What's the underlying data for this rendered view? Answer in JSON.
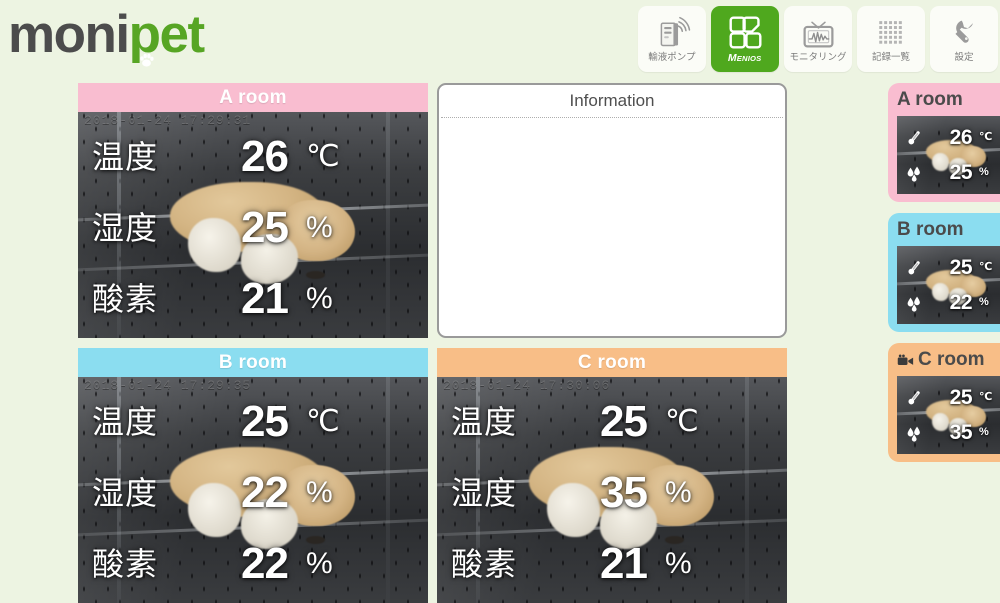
{
  "brand": {
    "name_part1": "moni",
    "name_part2": "pet",
    "paw_icon": "paw-print-icon",
    "color_dark": "#4c4c4c",
    "color_green": "#57a524"
  },
  "toolbar": {
    "buttons": [
      {
        "id": "infusion-pump",
        "label": "輸液ポンプ",
        "icon": "infusion-pump-icon",
        "active": false
      },
      {
        "id": "menios",
        "label": "Menios",
        "icon": "grid-squares-icon",
        "active": true
      },
      {
        "id": "monitoring",
        "label": "モニタリング",
        "icon": "monitor-waveform-icon",
        "active": false
      },
      {
        "id": "record-list",
        "label": "記録一覧",
        "icon": "dot-grid-icon",
        "active": false
      },
      {
        "id": "settings",
        "label": "設定",
        "icon": "wrench-icon",
        "active": false
      }
    ]
  },
  "info_panel": {
    "title": "Information",
    "body_text": ""
  },
  "rooms": [
    {
      "id": "a",
      "title": "A room",
      "header_color": "#f9bdd0",
      "timestamp": "2018-01-24 17:29:31",
      "readouts": [
        {
          "label": "温度",
          "value": "26",
          "unit": "℃"
        },
        {
          "label": "湿度",
          "value": "25",
          "unit": "%"
        },
        {
          "label": "酸素",
          "value": "21",
          "unit": "%"
        }
      ]
    },
    {
      "id": "b",
      "title": "B room",
      "header_color": "#8bddf0",
      "timestamp": "2018-01-24 17:29:35",
      "readouts": [
        {
          "label": "温度",
          "value": "25",
          "unit": "℃"
        },
        {
          "label": "湿度",
          "value": "22",
          "unit": "%"
        },
        {
          "label": "酸素",
          "value": "22",
          "unit": "%"
        }
      ]
    },
    {
      "id": "c",
      "title": "C room",
      "header_color": "#f8be87",
      "timestamp": "2018-01-24 17:30:06",
      "readouts": [
        {
          "label": "温度",
          "value": "25",
          "unit": "℃"
        },
        {
          "label": "湿度",
          "value": "35",
          "unit": "%"
        },
        {
          "label": "酸素",
          "value": "21",
          "unit": "%"
        }
      ]
    }
  ],
  "sidebar": {
    "cards": [
      {
        "id": "a",
        "title": "A room",
        "color": "#f9bdd0",
        "has_camera_icon": false,
        "temperature": {
          "icon": "thermometer-icon",
          "value": "26",
          "unit": "℃"
        },
        "humidity": {
          "icon": "water-drops-icon",
          "value": "25",
          "unit": "%"
        }
      },
      {
        "id": "b",
        "title": "B room",
        "color": "#8bddf0",
        "has_camera_icon": false,
        "temperature": {
          "icon": "thermometer-icon",
          "value": "25",
          "unit": "℃"
        },
        "humidity": {
          "icon": "water-drops-icon",
          "value": "22",
          "unit": "%"
        }
      },
      {
        "id": "c",
        "title": "C room",
        "color": "#f8be87",
        "has_camera_icon": true,
        "camera_icon": "video-camera-icon",
        "temperature": {
          "icon": "thermometer-icon",
          "value": "25",
          "unit": "℃"
        },
        "humidity": {
          "icon": "water-drops-icon",
          "value": "35",
          "unit": "%"
        }
      }
    ]
  },
  "theme": {
    "page_background": "#edf4e2",
    "accent_green": "#4fa81e",
    "panel_white": "#ffffff"
  }
}
